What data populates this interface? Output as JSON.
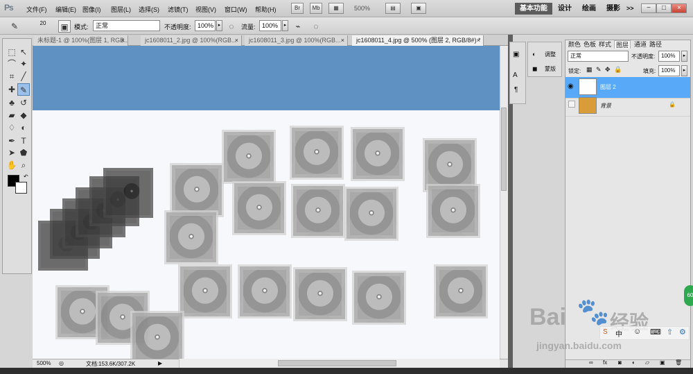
{
  "menubar": {
    "logo": "Ps",
    "items": [
      "文件(F)",
      "编辑(E)",
      "图像(I)",
      "图层(L)",
      "选择(S)",
      "滤镜(T)",
      "视图(V)",
      "窗口(W)",
      "帮助(H)"
    ],
    "zoom": "500%",
    "workspace": [
      "基本功能",
      "设计",
      "绘画",
      "摄影"
    ],
    "more": ">>"
  },
  "options": {
    "brush_size": "20",
    "mode_label": "模式:",
    "mode_value": "正常",
    "opacity_label": "不透明度:",
    "opacity_value": "100%",
    "flow_label": "流量:",
    "flow_value": "100%"
  },
  "tabs": [
    {
      "label": "未标题-1 @ 100%(图层 1, RGB..."
    },
    {
      "label": "jc1608011_2.jpg @ 100%(RGB..."
    },
    {
      "label": "jc1608011_3.jpg @ 100%(RGB..."
    },
    {
      "label": "jc1608011_4.jpg @ 500% (图层 2, RGB/8#) *"
    }
  ],
  "status": {
    "zoom": "500%",
    "doc": "文档:153.6K/307.2K"
  },
  "adjust_panel": {
    "adjust": "调整",
    "mask": "蒙版"
  },
  "layers_panel": {
    "tabs": [
      "颜色",
      "色板",
      "样式",
      "图层",
      "通道",
      "路径"
    ],
    "blend_mode": "正常",
    "opacity_label": "不透明度:",
    "opacity_value": "100%",
    "lock_label": "锁定:",
    "fill_label": "填充:",
    "fill_value": "100%",
    "layers": [
      {
        "name": "图层 2",
        "selected": true
      },
      {
        "name": "背景",
        "selected": false
      }
    ]
  },
  "watermark": {
    "brand": "Bai",
    "brand_chinese": "经验",
    "url": "jingyan.baidu.com",
    "badge": "60"
  }
}
